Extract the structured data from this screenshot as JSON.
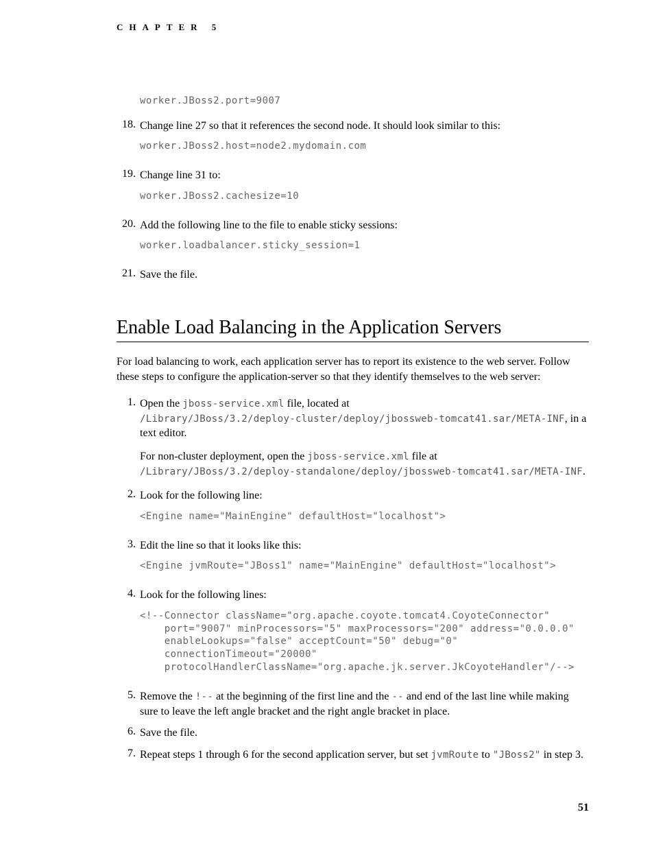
{
  "chapter": "CHAPTER 5",
  "items_top": {
    "code17": "worker.JBoss2.port=9007",
    "n18": "18.",
    "t18": "Change line 27 so that it references the second node. It should look similar to this:",
    "code18": "worker.JBoss2.host=node2.mydomain.com",
    "n19": "19.",
    "t19": "Change line 31 to:",
    "code19": "worker.JBoss2.cachesize=10",
    "n20": "20.",
    "t20": "Add the following line to the file to enable sticky sessions:",
    "code20": "worker.loadbalancer.sticky_session=1",
    "n21": "21.",
    "t21": "Save the file."
  },
  "section": {
    "heading": "Enable Load Balancing in the Application Servers",
    "intro": "For load balancing to work, each application server has to report its existence to the web server. Follow these steps to configure the application-server so that they identify themselves to the web server:",
    "s1": {
      "n": "1.",
      "a": "Open the ",
      "code_a": "jboss-service.xml",
      "b": " file, located at ",
      "path1": "/Library/JBoss/3.2/deploy-cluster/deploy/jbossweb-tomcat41.sar/META-INF",
      "c": ", in a text editor.",
      "d": "For non-cluster deployment, open the ",
      "code_b": "jboss-service.xml",
      "e": " file at ",
      "path2": "/Library/JBoss/3.2/deploy-standalone/deploy/jbossweb-tomcat41.sar/META-INF",
      "f": "."
    },
    "s2": {
      "n": "2.",
      "t": "Look for the following line:",
      "code": "<Engine name=\"MainEngine\" defaultHost=\"localhost\">"
    },
    "s3": {
      "n": "3.",
      "t": "Edit the line so that it looks like this:",
      "code": "<Engine jvmRoute=\"JBoss1\" name=\"MainEngine\" defaultHost=\"localhost\">"
    },
    "s4": {
      "n": "4.",
      "t": "Look for the following lines:",
      "code": "<!--Connector className=\"org.apache.coyote.tomcat4.CoyoteConnector\"\n    port=\"9007\" minProcessors=\"5\" maxProcessors=\"200\" address=\"0.0.0.0\"\n    enableLookups=\"false\" acceptCount=\"50\" debug=\"0\"\n    connectionTimeout=\"20000\"\n    protocolHandlerClassName=\"org.apache.jk.server.JkCoyoteHandler\"/-->"
    },
    "s5": {
      "n": "5.",
      "a": "Remove the ",
      "code_a": "!--",
      "b": " at the beginning of the first line and the ",
      "code_b": "--",
      "c": " and end of the last line while making sure to leave the left angle bracket and the right angle bracket in place."
    },
    "s6": {
      "n": "6.",
      "t": "Save the file."
    },
    "s7": {
      "n": "7.",
      "a": "Repeat steps 1 through 6 for the second application server, but set ",
      "code_a": "jvmRoute",
      "b": " to ",
      "code_b": "\"JBoss2\"",
      "c": " in step 3."
    }
  },
  "page_number": "51"
}
